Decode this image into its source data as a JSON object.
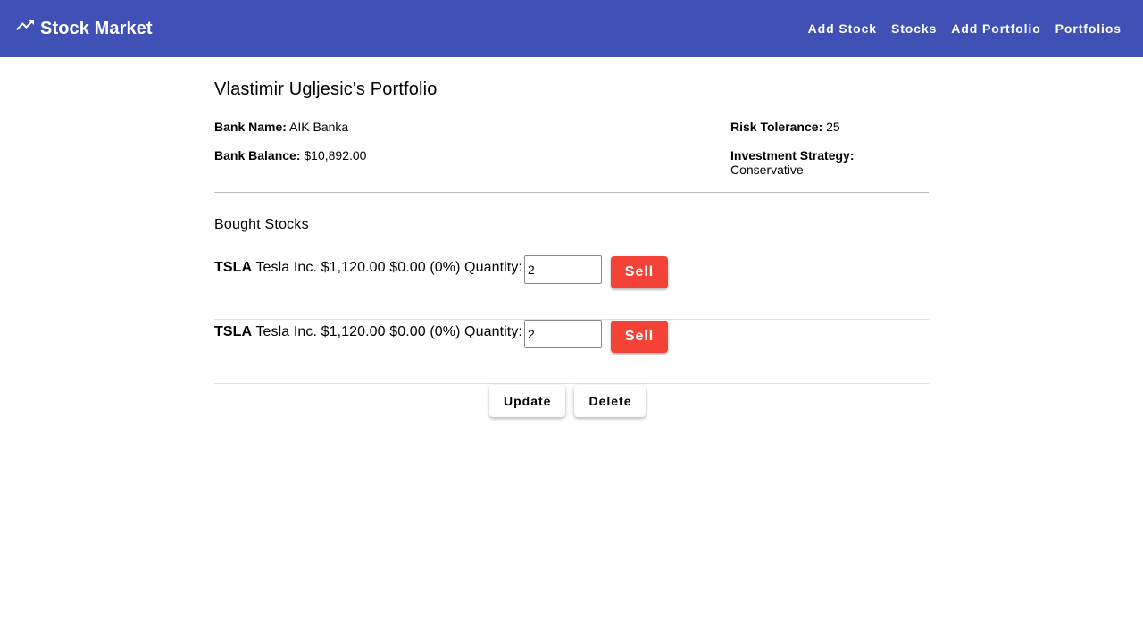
{
  "header": {
    "icon": "trending-up-icon",
    "title": "Stock Market",
    "nav": [
      "Add Stock",
      "Stocks",
      "Add Portfolio",
      "Portfolios"
    ]
  },
  "portfolio": {
    "title": "Vlastimir Ugljesic's Portfolio",
    "bank_name_label": "Bank Name:",
    "bank_name": "AIK Banka",
    "bank_balance_label": "Bank Balance:",
    "bank_balance": "$10,892.00",
    "risk_tolerance_label": "Risk Tolerance:",
    "risk_tolerance": "25",
    "investment_strategy_label": "Investment Strategy:",
    "investment_strategy": "Conservative"
  },
  "bought_stocks": {
    "title": "Bought Stocks",
    "quantity_label": "Quantity:",
    "sell_label": "Sell",
    "items": [
      {
        "symbol": "TSLA",
        "name": "Tesla Inc.",
        "price": "$1,120.00",
        "change": "$0.00 (0%)",
        "quantity": "2"
      },
      {
        "symbol": "TSLA",
        "name": "Tesla Inc.",
        "price": "$1,120.00",
        "change": "$0.00 (0%)",
        "quantity": "2"
      }
    ]
  },
  "actions": {
    "update_label": "Update",
    "delete_label": "Delete"
  },
  "colors": {
    "toolbar": "#3f51b5",
    "sell_button": "#f44336"
  }
}
